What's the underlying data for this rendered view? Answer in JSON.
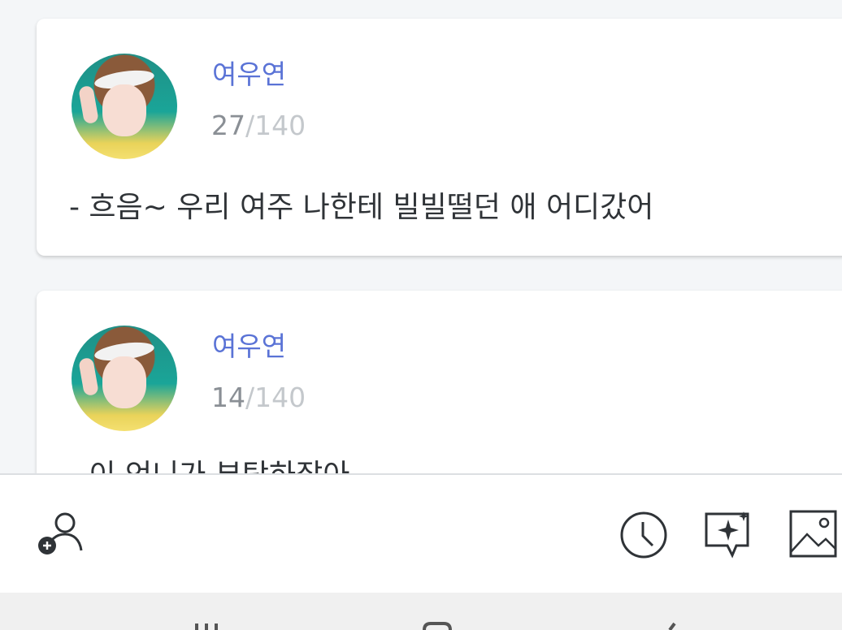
{
  "posts": [
    {
      "author": "여우연",
      "count": "27",
      "max": "/140",
      "text": "- 흐음~ 우리 여주 나한테 빌빌떨던 애 어디갔어"
    },
    {
      "author": "여우연",
      "count": "14",
      "max": "/140",
      "text": "- 이 언니가 부탁하잖아"
    }
  ],
  "toolbar": {
    "icons": [
      "add-user-icon",
      "clock-icon",
      "sparkle-chat-icon",
      "image-icon"
    ]
  },
  "navbar": {
    "icons": [
      "recent-apps-icon",
      "home-icon",
      "back-icon"
    ]
  },
  "colors": {
    "accent": "#5a73d6",
    "counter": "#8a8f95",
    "counter_max": "#c4c8cc"
  }
}
